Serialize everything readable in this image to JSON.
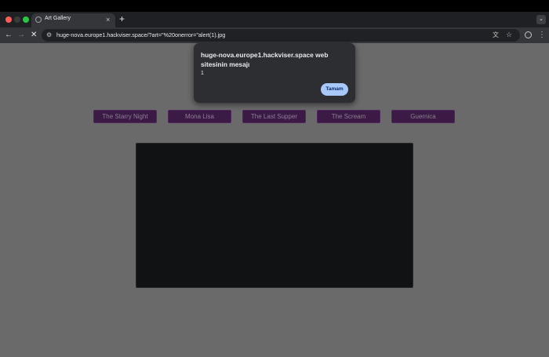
{
  "browser": {
    "tab": {
      "title": "Art Gallery",
      "close_glyph": "×"
    },
    "new_tab_glyph": "+",
    "nav": {
      "back_glyph": "←",
      "forward_glyph": "→",
      "stop_glyph": "✕"
    },
    "address_bar": {
      "url": "huge-nova.europe1.hackviser.space/?art=\"%20onerror=\"alert(1).jpg"
    }
  },
  "dialog": {
    "title": "huge-nova.europe1.hackviser.space web sitesinin mesajı",
    "message": "1",
    "ok_label": "Tamam"
  },
  "gallery": {
    "buttons": [
      "The Starry Night",
      "Mona Lisa",
      "The Last Supper",
      "The Scream",
      "Guernica"
    ]
  },
  "icons": {
    "site_info": "tune-icon",
    "translate": "translate-icon",
    "bookmark": "star-icon",
    "profile": "profile-icon",
    "menu": "kebab-menu-icon"
  },
  "colors": {
    "page_background": "#6a6a6a",
    "button_background": "#3b1a45",
    "dialog_button": "#a8c7fa"
  }
}
